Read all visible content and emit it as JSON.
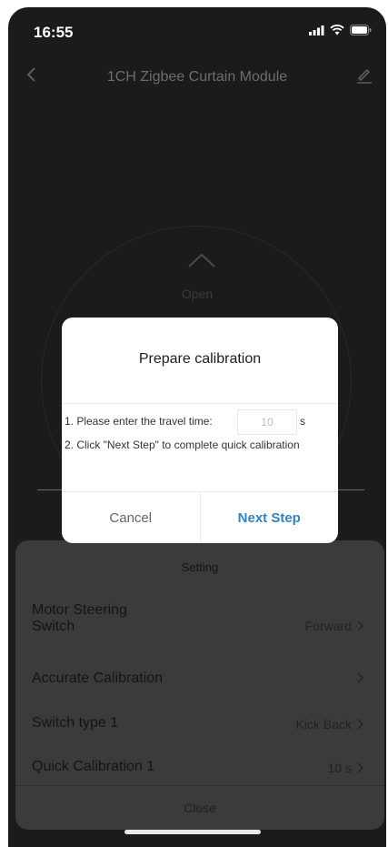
{
  "status_bar": {
    "time": "16:55"
  },
  "nav": {
    "title": "1CH Zigbee Curtain Module"
  },
  "control": {
    "open_label": "Open"
  },
  "dialog": {
    "title": "Prepare calibration",
    "line1": "1. Please enter the travel time:",
    "travel_time_value": "10",
    "unit": "s",
    "line2": "2. Click \"Next Step\" to complete quick calibration",
    "cancel_label": "Cancel",
    "next_label": "Next Step",
    "accent_color": "#2a86c8"
  },
  "settings": {
    "title": "Setting",
    "rows": [
      {
        "label": "Motor Steering\nSwitch",
        "value": "Forward"
      },
      {
        "label": "Accurate Calibration",
        "value": ""
      },
      {
        "label": "Switch type 1",
        "value": "Kick Back"
      },
      {
        "label": "Quick Calibration 1",
        "value": "10 s"
      }
    ],
    "close_label": "Close"
  }
}
